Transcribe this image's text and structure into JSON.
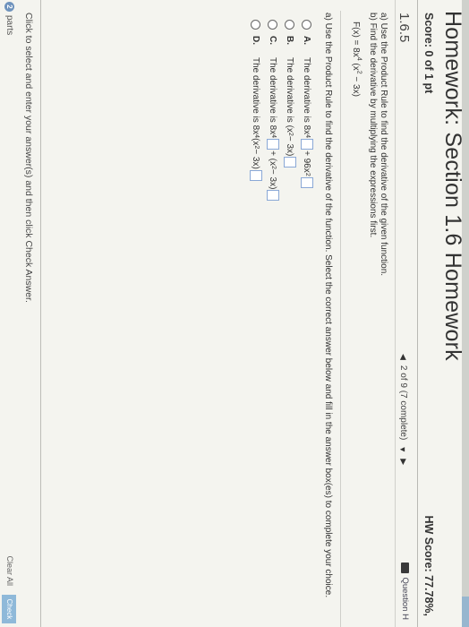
{
  "header": {
    "title": "Homework: Section 1.6 Homework",
    "score": "Score: 0 of 1 pt",
    "hw_score": "HW Score: 77.78%,"
  },
  "question_bar": {
    "section": "1.6.5",
    "progress": "2 of 9 (7 complete)",
    "help_label": "Question H"
  },
  "problem": {
    "line_a": "a) Use the Product Rule to find the derivative of the given function.",
    "line_b": "b) Find the derivative by multiplying the expressions first.",
    "function": {
      "prefix": "F(x) = 8x",
      "exp1": "4",
      "mid": " (x",
      "exp2": "2",
      "suffix": " − 3x)"
    }
  },
  "part_a": {
    "instruction": "a) Use the Product Rule to find the derivative of the function. Select the correct answer below and fill in the answer box(es) to complete your choice.",
    "options": [
      {
        "letter": "A.",
        "pre": "The derivative is 8x",
        "e1": "4",
        "t1": "+ 96x",
        "e2": "2"
      },
      {
        "letter": "B.",
        "pre": "The derivative is (x",
        "e1": "2",
        "t1": " − 3x)"
      },
      {
        "letter": "C.",
        "pre": "The derivative is 8x",
        "e1": "4",
        "t1": "+ (x",
        "e2": "2",
        "t2": " − 3x)"
      },
      {
        "letter": "D.",
        "pre": "The derivative is 8x",
        "e1": "4",
        "t1": " (x",
        "e2": "2",
        "t2": " − 3x)"
      }
    ]
  },
  "footer": {
    "instruction": "Click to select and enter your answer(s) and then click Check Answer.",
    "parts_count": "2",
    "parts_label": "parts",
    "clear_all": "Clear All",
    "check_answer": "Check Ans"
  }
}
